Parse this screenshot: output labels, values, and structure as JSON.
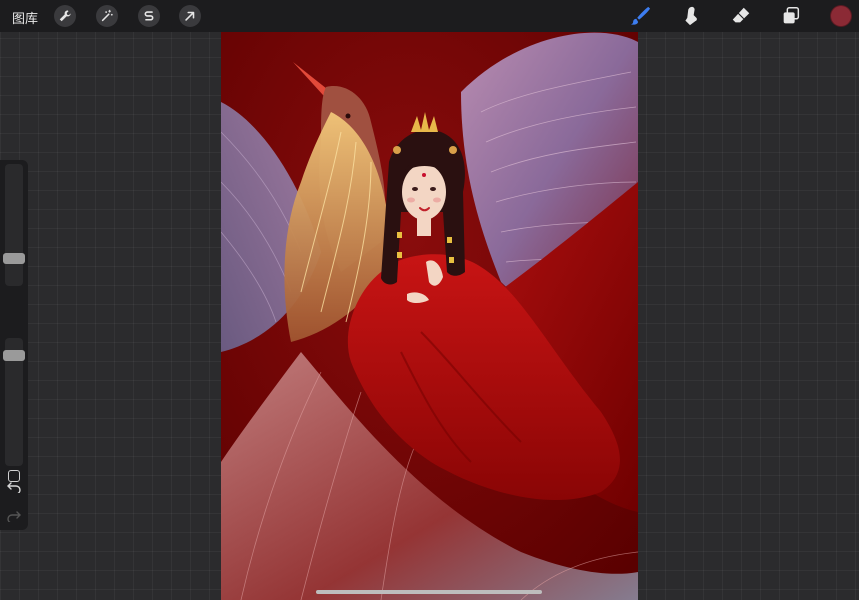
{
  "topbar": {
    "gallery_label": "图库",
    "left_tools": [
      {
        "name": "actions",
        "icon": "wrench-icon"
      },
      {
        "name": "adjustments",
        "icon": "magic-wand-icon"
      },
      {
        "name": "selection",
        "icon": "selection-s-icon"
      },
      {
        "name": "transform",
        "icon": "arrow-cursor-icon"
      }
    ],
    "right_tools": [
      {
        "name": "brush",
        "icon": "brush-icon",
        "active": true
      },
      {
        "name": "smudge",
        "icon": "smudge-finger-icon",
        "active": false
      },
      {
        "name": "eraser",
        "icon": "eraser-icon",
        "active": false
      },
      {
        "name": "layers",
        "icon": "layers-icon",
        "active": false
      }
    ],
    "current_color": "#8b2a35"
  },
  "sidebar": {
    "brush_size_level": 0.2,
    "brush_opacity_level": 0.9,
    "undo_icon": "undo-icon",
    "redo_icon": "redo-icon"
  },
  "colors": {
    "active_tool": "#3d7df0",
    "canvas_bg": "#7a0a0a"
  }
}
